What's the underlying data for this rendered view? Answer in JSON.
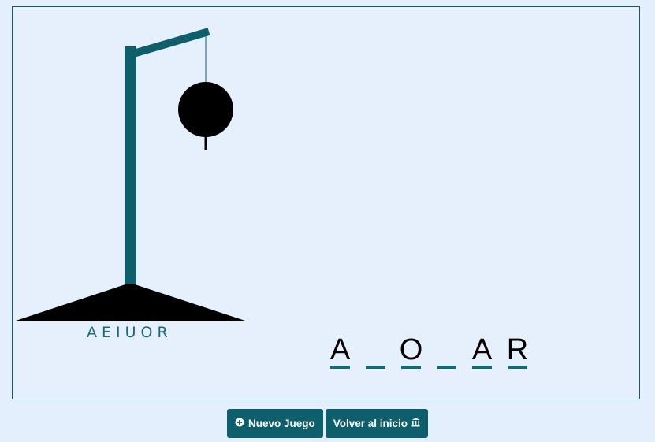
{
  "game": {
    "used_letters": "AEIUOR",
    "word_slots": [
      "A",
      "",
      "O",
      "",
      "A",
      "R"
    ]
  },
  "buttons": {
    "new_game": {
      "label": "Nuevo Juego",
      "icon": "plus-circle-icon"
    },
    "back_home": {
      "label": "Volver al inicio",
      "icon": "bank-icon"
    }
  },
  "colors": {
    "accent": "#0d5f6b",
    "board_bg": "#e6f0fd",
    "page_bg": "#e3effd"
  }
}
